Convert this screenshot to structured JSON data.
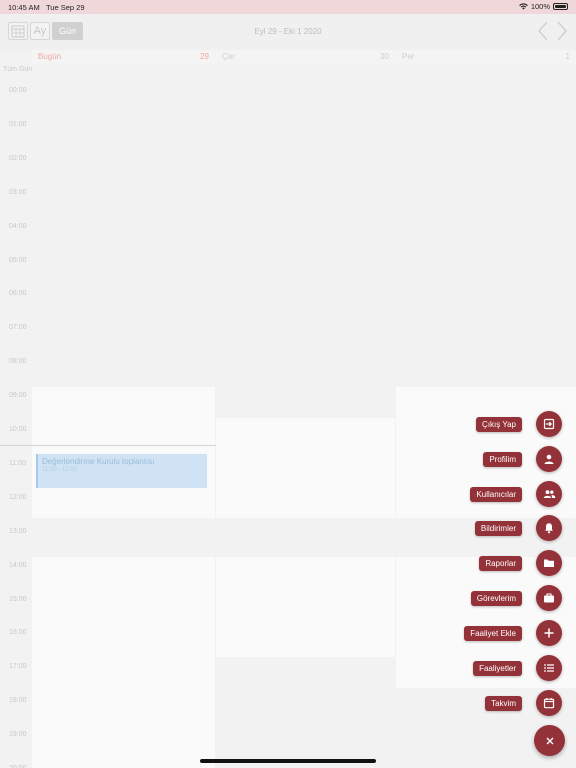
{
  "status_bar": {
    "time": "10:45 AM",
    "date": "Tue Sep 29",
    "battery": "100%"
  },
  "toolbar": {
    "month_label": "Ay",
    "day_label": "Gün",
    "date_range": "Eyl 29 - Eki 1 2020"
  },
  "days": [
    {
      "name": "Bugün",
      "number": "29"
    },
    {
      "name": "Çar",
      "number": "30"
    },
    {
      "name": "Per",
      "number": "1"
    }
  ],
  "all_day_label": "Tüm Gün",
  "hours": [
    "00:00",
    "01:00",
    "02:00",
    "03:00",
    "04:00",
    "05:00",
    "06:00",
    "07:00",
    "08:00",
    "09:00",
    "10:00",
    "11:00",
    "12:00",
    "13:00",
    "14:00",
    "15:00",
    "16:00",
    "17:00",
    "18:00",
    "19:00",
    "20:00"
  ],
  "event": {
    "title": "Değerlendirme Kurulu toplantısı",
    "time": "11:00 - 12:00"
  },
  "menu": [
    {
      "label": "Çıkış Yap",
      "icon": "logout-icon"
    },
    {
      "label": "Profilim",
      "icon": "person-icon"
    },
    {
      "label": "Kullanıcılar",
      "icon": "people-icon"
    },
    {
      "label": "Bildirimler",
      "icon": "bell-icon"
    },
    {
      "label": "Raporlar",
      "icon": "folder-icon"
    },
    {
      "label": "Görevlerim",
      "icon": "briefcase-icon"
    },
    {
      "label": "Faaliyet Ekle",
      "icon": "plus-icon"
    },
    {
      "label": "Faaliyetler",
      "icon": "list-icon"
    },
    {
      "label": "Takvim",
      "icon": "calendar-icon"
    }
  ],
  "colors": {
    "accent": "#943239",
    "status_bar": "#f0d7da",
    "event": "#cfe3f5"
  }
}
